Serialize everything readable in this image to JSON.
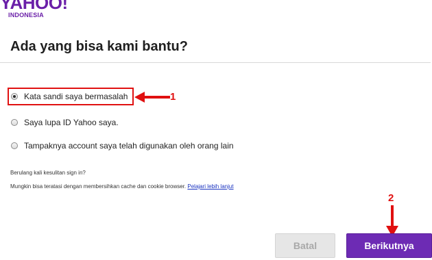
{
  "brand": {
    "logo_text": "YAHOO!",
    "logo_subtext": "INDONESIA",
    "color": "#6a1fa8"
  },
  "page": {
    "title": "Ada yang bisa kami bantu?"
  },
  "options": [
    {
      "label": "Kata sandi saya bermasalah",
      "selected": true
    },
    {
      "label": "Saya lupa ID Yahoo saya.",
      "selected": false
    },
    {
      "label": "Tampaknya account saya telah digunakan oleh orang lain",
      "selected": false
    }
  ],
  "help": {
    "question": "Berulang kali kesulitan sign in?",
    "tip": "Mungkin bisa teratasi dengan membersihkan cache dan cookie browser.",
    "link_label": "Pelajari lebih lanjut"
  },
  "buttons": {
    "cancel_label": "Batal",
    "next_label": "Berikutnya"
  },
  "annotations": {
    "step1": "1",
    "step2": "2",
    "color": "#e01010"
  }
}
